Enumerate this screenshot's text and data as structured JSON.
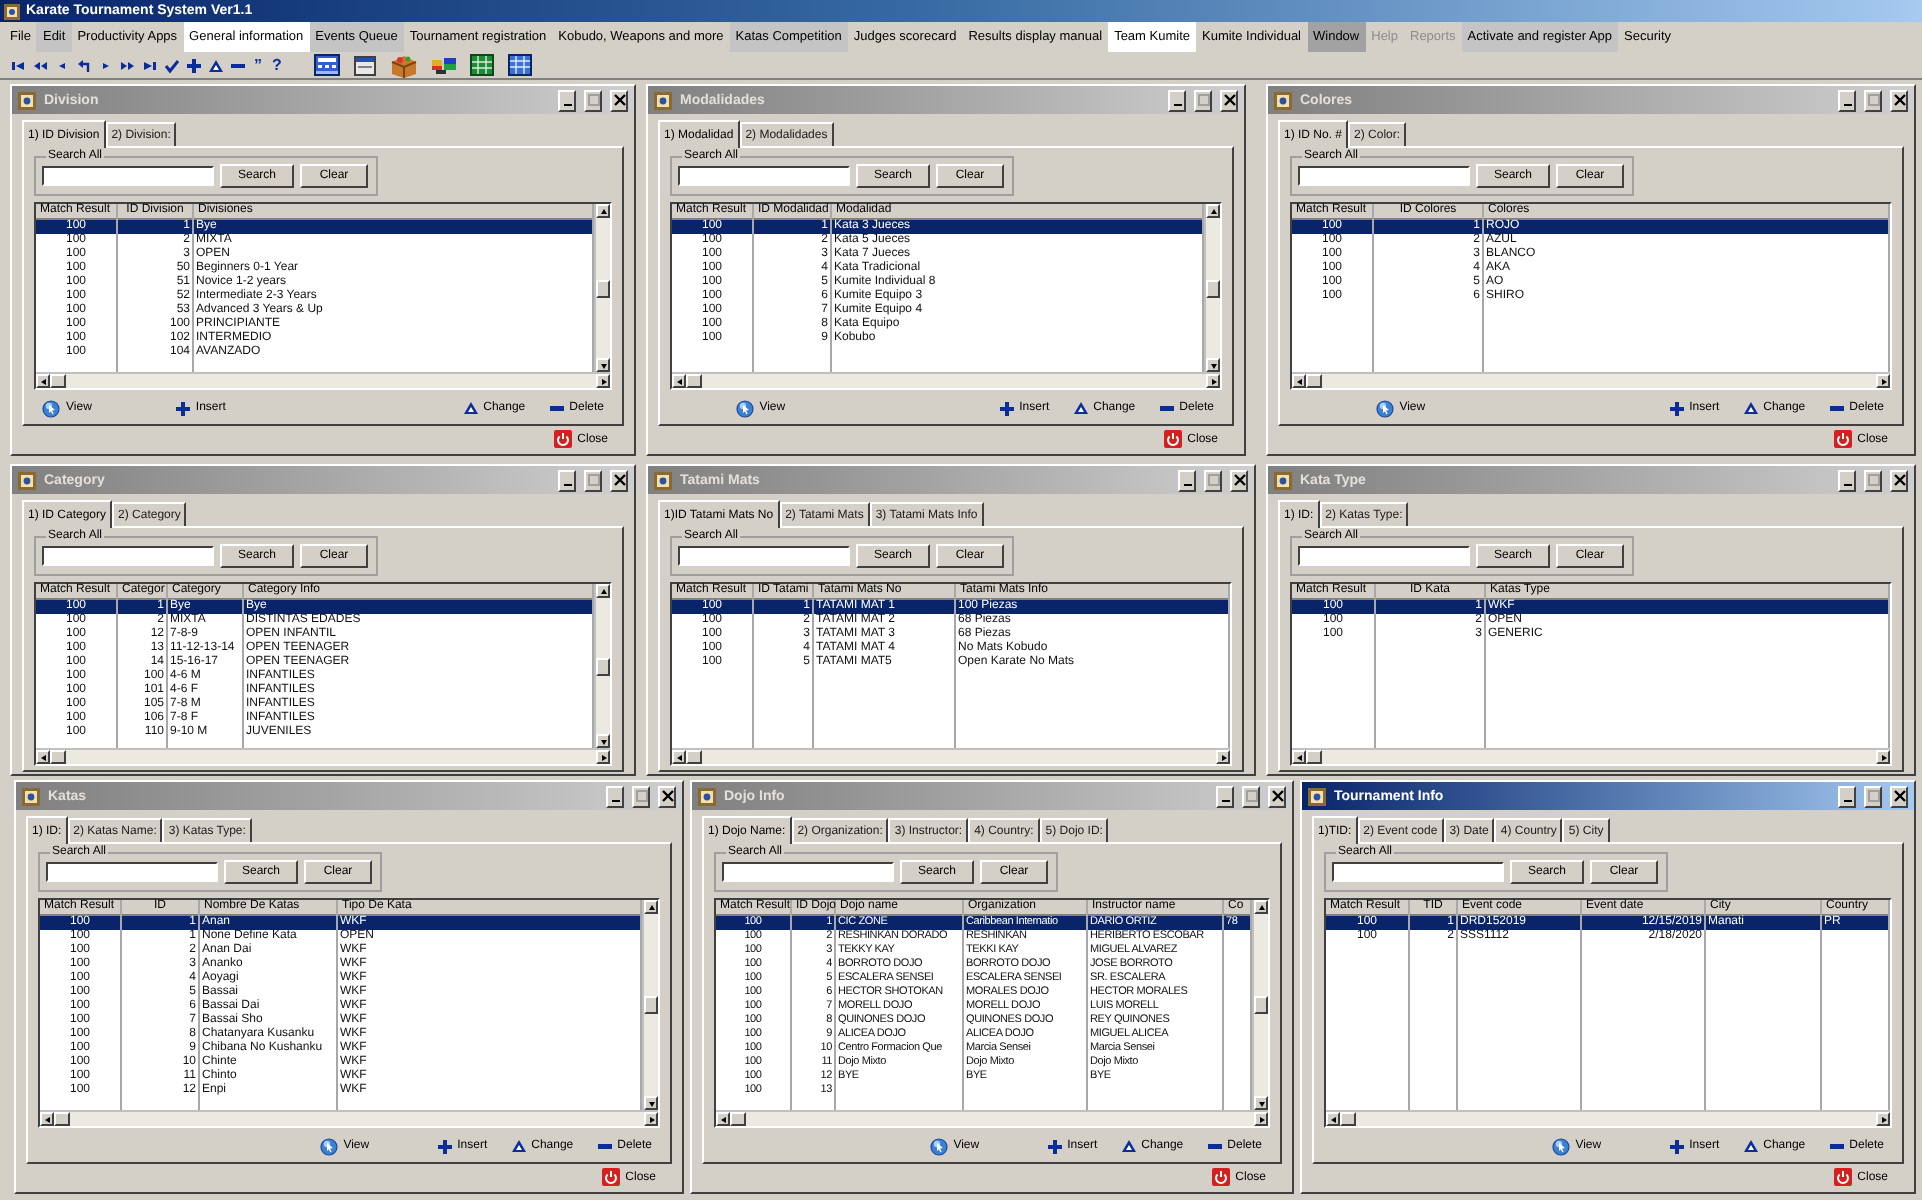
{
  "app_title": "Karate Tournament System Ver1.1",
  "menu": [
    {
      "label": "File",
      "kind": "plain",
      "disabled": false
    },
    {
      "label": "Edit",
      "kind": "shaded",
      "disabled": false
    },
    {
      "label": "Productivity Apps",
      "kind": "plain",
      "disabled": false
    },
    {
      "label": "General information",
      "kind": "light",
      "disabled": false
    },
    {
      "label": "Events Queue",
      "kind": "shaded",
      "disabled": false
    },
    {
      "label": "Tournament registration",
      "kind": "plain",
      "disabled": false
    },
    {
      "label": "Kobudo, Weapons and more",
      "kind": "plain",
      "disabled": false
    },
    {
      "label": "Katas Competition",
      "kind": "shaded",
      "disabled": false
    },
    {
      "label": "Judges scorecard",
      "kind": "plain",
      "disabled": false
    },
    {
      "label": "Results display manual",
      "kind": "plain",
      "disabled": false
    },
    {
      "label": "Team Kumite",
      "kind": "light",
      "disabled": false
    },
    {
      "label": "Kumite Individual",
      "kind": "plain",
      "disabled": false
    },
    {
      "label": "Window",
      "kind": "dark",
      "disabled": false
    },
    {
      "label": "Help",
      "kind": "plain",
      "disabled": true
    },
    {
      "label": "Reports",
      "kind": "plain",
      "disabled": true
    },
    {
      "label": "Activate and register App",
      "kind": "shaded",
      "disabled": false
    },
    {
      "label": "Security",
      "kind": "plain",
      "disabled": false
    }
  ],
  "toolbar": [
    {
      "kind": "first"
    },
    {
      "kind": "rewind"
    },
    {
      "kind": "previous"
    },
    {
      "kind": "undo"
    },
    {
      "kind": "next"
    },
    {
      "kind": "fast-forward"
    },
    {
      "kind": "last"
    },
    {
      "kind": "check"
    },
    {
      "kind": "add"
    },
    {
      "kind": "edit"
    },
    {
      "kind": "remove"
    },
    {
      "kind": "glyph",
      "text": "”"
    },
    {
      "kind": "glyph",
      "text": "?"
    },
    {
      "kind": "calculator"
    },
    {
      "kind": "window"
    },
    {
      "kind": "box"
    },
    {
      "kind": "flags"
    },
    {
      "kind": "sheet"
    },
    {
      "kind": "chart"
    }
  ],
  "windows": [
    {
      "title": "Division",
      "active": false,
      "tabs": [
        {
          "label": "1) ID Division",
          "selected": true
        },
        {
          "label": "2) Division:",
          "selected": false
        }
      ],
      "search_group": "Search All",
      "search_button": "Search",
      "clear_button": "Clear",
      "table": {
        "columns": [
          "Match Result",
          "ID Division",
          "Divisiones"
        ],
        "rows": [
          {
            "cells": [
              "100",
              "1",
              "Bye"
            ],
            "selected": true
          },
          {
            "cells": [
              "100",
              "2",
              "MIXTA"
            ],
            "selected": false
          },
          {
            "cells": [
              "100",
              "3",
              "OPEN"
            ],
            "selected": false
          },
          {
            "cells": [
              "100",
              "50",
              "Beginners 0-1 Year"
            ],
            "selected": false
          },
          {
            "cells": [
              "100",
              "51",
              "Novice 1-2 years"
            ],
            "selected": false
          },
          {
            "cells": [
              "100",
              "52",
              "Intermediate 2-3 Years"
            ],
            "selected": false
          },
          {
            "cells": [
              "100",
              "53",
              "Advanced 3 Years & Up"
            ],
            "selected": false
          },
          {
            "cells": [
              "100",
              "100",
              "PRINCIPIANTE"
            ],
            "selected": false
          },
          {
            "cells": [
              "100",
              "102",
              "INTERMEDIO"
            ],
            "selected": false
          },
          {
            "cells": [
              "100",
              "104",
              "AVANZADO"
            ],
            "selected": false
          }
        ]
      },
      "actions": [
        "View",
        "Insert",
        "Change",
        "Delete"
      ],
      "close_button": "Close"
    },
    {
      "title": "Modalidades",
      "active": false,
      "tabs": [
        {
          "label": "1) Modalidad",
          "selected": true
        },
        {
          "label": "2) Modalidades",
          "selected": false
        }
      ],
      "search_group": "Search All",
      "search_button": "Search",
      "clear_button": "Clear",
      "table": {
        "columns": [
          "Match Result",
          "ID Modalidad",
          "Modalidad"
        ],
        "rows": [
          {
            "cells": [
              "100",
              "1",
              "Kata 3 Jueces"
            ],
            "selected": true
          },
          {
            "cells": [
              "100",
              "2",
              "Kata 5 Jueces"
            ],
            "selected": false
          },
          {
            "cells": [
              "100",
              "3",
              "Kata 7 Jueces"
            ],
            "selected": false
          },
          {
            "cells": [
              "100",
              "4",
              "Kata Tradicional"
            ],
            "selected": false
          },
          {
            "cells": [
              "100",
              "5",
              "Kumite Individual 8"
            ],
            "selected": false
          },
          {
            "cells": [
              "100",
              "6",
              "Kumite Equipo 3"
            ],
            "selected": false
          },
          {
            "cells": [
              "100",
              "7",
              "Kumite Equipo 4"
            ],
            "selected": false
          },
          {
            "cells": [
              "100",
              "8",
              "Kata Equipo"
            ],
            "selected": false
          },
          {
            "cells": [
              "100",
              "9",
              "Kobubo"
            ],
            "selected": false
          }
        ]
      },
      "actions": [
        "View",
        "Insert",
        "Change",
        "Delete"
      ],
      "close_button": "Close"
    },
    {
      "title": "Colores",
      "active": false,
      "tabs": [
        {
          "label": "1) ID No. #",
          "selected": true
        },
        {
          "label": "2) Color:",
          "selected": false
        }
      ],
      "search_group": "Search All",
      "search_button": "Search",
      "clear_button": "Clear",
      "table": {
        "columns": [
          "Match Result",
          "ID Colores",
          "Colores"
        ],
        "rows": [
          {
            "cells": [
              "100",
              "1",
              "ROJO"
            ],
            "selected": true
          },
          {
            "cells": [
              "100",
              "2",
              "AZUL"
            ],
            "selected": false
          },
          {
            "cells": [
              "100",
              "3",
              "BLANCO"
            ],
            "selected": false
          },
          {
            "cells": [
              "100",
              "4",
              "AKA"
            ],
            "selected": false
          },
          {
            "cells": [
              "100",
              "5",
              "AO"
            ],
            "selected": false
          },
          {
            "cells": [
              "100",
              "6",
              "SHIRO"
            ],
            "selected": false
          }
        ]
      },
      "actions": [
        "View",
        "Insert",
        "Change",
        "Delete"
      ],
      "close_button": "Close"
    },
    {
      "title": "Category",
      "active": false,
      "tabs": [
        {
          "label": "1) ID Category",
          "selected": true
        },
        {
          "label": "2) Category",
          "selected": false
        }
      ],
      "search_group": "Search All",
      "search_button": "Search",
      "clear_button": "Clear",
      "table": {
        "columns": [
          "Match Result",
          "Categor",
          "Category",
          "Category Info"
        ],
        "rows": [
          {
            "cells": [
              "100",
              "1",
              "Bye",
              "Bye"
            ],
            "selected": true
          },
          {
            "cells": [
              "100",
              "2",
              "MIXTA",
              "DISTINTAS EDADES"
            ],
            "selected": false
          },
          {
            "cells": [
              "100",
              "12",
              "7-8-9",
              "OPEN INFANTIL"
            ],
            "selected": false
          },
          {
            "cells": [
              "100",
              "13",
              "11-12-13-14",
              "OPEN TEENAGER"
            ],
            "selected": false
          },
          {
            "cells": [
              "100",
              "14",
              "15-16-17",
              "OPEN  TEENAGER"
            ],
            "selected": false
          },
          {
            "cells": [
              "100",
              "100",
              "4-6 M",
              "INFANTILES"
            ],
            "selected": false
          },
          {
            "cells": [
              "100",
              "101",
              "4-6 F",
              "INFANTILES"
            ],
            "selected": false
          },
          {
            "cells": [
              "100",
              "105",
              "7-8 M",
              "INFANTILES"
            ],
            "selected": false
          },
          {
            "cells": [
              "100",
              "106",
              "7-8 F",
              "INFANTILES"
            ],
            "selected": false
          },
          {
            "cells": [
              "100",
              "110",
              "9-10 M",
              "JUVENILES"
            ],
            "selected": false
          }
        ]
      }
    },
    {
      "title": "Tatami Mats",
      "active": false,
      "tabs": [
        {
          "label": "1)ID Tatami Mats No",
          "selected": true
        },
        {
          "label": "2) Tatami Mats",
          "selected": false
        },
        {
          "label": "3) Tatami Mats Info",
          "selected": false
        }
      ],
      "search_group": "Search All",
      "search_button": "Search",
      "clear_button": "Clear",
      "table": {
        "columns": [
          "Match Result",
          "ID Tatami",
          "Tatami Mats No",
          "Tatami Mats Info"
        ],
        "rows": [
          {
            "cells": [
              "100",
              "1",
              "TATAMI MAT 1",
              "100 Piezas"
            ],
            "selected": true
          },
          {
            "cells": [
              "100",
              "2",
              "TATAMI MAT 2",
              "68 Piezas"
            ],
            "selected": false
          },
          {
            "cells": [
              "100",
              "3",
              "TATAMI MAT 3",
              "68 Piezas"
            ],
            "selected": false
          },
          {
            "cells": [
              "100",
              "4",
              "TATAMI MAT 4",
              "No Mats Kobudo"
            ],
            "selected": false
          },
          {
            "cells": [
              "100",
              "5",
              "TATAMI MAT5",
              "Open Karate No Mats"
            ],
            "selected": false
          }
        ]
      }
    },
    {
      "title": "Kata Type",
      "active": false,
      "tabs": [
        {
          "label": "1) ID:",
          "selected": true
        },
        {
          "label": "2) Katas Type:",
          "selected": false
        }
      ],
      "search_group": "Search All",
      "search_button": "Search",
      "clear_button": "Clear",
      "table": {
        "columns": [
          "Match Result",
          "ID Kata",
          "Katas Type"
        ],
        "rows": [
          {
            "cells": [
              "100",
              "1",
              "WKF"
            ],
            "selected": true
          },
          {
            "cells": [
              "100",
              "2",
              "OPEN"
            ],
            "selected": false
          },
          {
            "cells": [
              "100",
              "3",
              "GENERIC"
            ],
            "selected": false
          }
        ]
      }
    },
    {
      "title": "Katas",
      "active": false,
      "tabs": [
        {
          "label": "1) ID:",
          "selected": true
        },
        {
          "label": "2) Katas Name:",
          "selected": false
        },
        {
          "label": "3) Katas Type:",
          "selected": false
        }
      ],
      "search_group": "Search All",
      "search_button": "Search",
      "clear_button": "Clear",
      "table": {
        "columns": [
          "Match Result",
          "ID",
          "Nombre De Katas",
          "Tipo De Kata"
        ],
        "rows": [
          {
            "cells": [
              "100",
              "1",
              "Anan",
              "WKF"
            ],
            "selected": true
          },
          {
            "cells": [
              "100",
              "1",
              "None Define Kata",
              "OPEN"
            ],
            "selected": false
          },
          {
            "cells": [
              "100",
              "2",
              "Anan Dai",
              "WKF"
            ],
            "selected": false
          },
          {
            "cells": [
              "100",
              "3",
              "Ananko",
              "WKF"
            ],
            "selected": false
          },
          {
            "cells": [
              "100",
              "4",
              "Aoyagi",
              "WKF"
            ],
            "selected": false
          },
          {
            "cells": [
              "100",
              "5",
              "Bassai",
              "WKF"
            ],
            "selected": false
          },
          {
            "cells": [
              "100",
              "6",
              "Bassai Dai",
              "WKF"
            ],
            "selected": false
          },
          {
            "cells": [
              "100",
              "7",
              "Bassai Sho",
              "WKF"
            ],
            "selected": false
          },
          {
            "cells": [
              "100",
              "8",
              "Chatanyara Kusanku",
              "WKF"
            ],
            "selected": false
          },
          {
            "cells": [
              "100",
              "9",
              "Chibana No Kushanku",
              "WKF"
            ],
            "selected": false
          },
          {
            "cells": [
              "100",
              "10",
              "Chinte",
              "WKF"
            ],
            "selected": false
          },
          {
            "cells": [
              "100",
              "11",
              "Chinto",
              "WKF"
            ],
            "selected": false
          },
          {
            "cells": [
              "100",
              "12",
              "Enpi",
              "WKF"
            ],
            "selected": false
          }
        ]
      },
      "actions": [
        "View",
        "Insert",
        "Change",
        "Delete"
      ],
      "close_button": "Close"
    },
    {
      "title": "Dojo Info",
      "active": false,
      "tabs": [
        {
          "label": "1) Dojo Name:",
          "selected": true
        },
        {
          "label": "2) Organization:",
          "selected": false
        },
        {
          "label": "3) Instructor:",
          "selected": false
        },
        {
          "label": "4) Country:",
          "selected": false
        },
        {
          "label": "5) Dojo ID:",
          "selected": false
        }
      ],
      "search_group": "Search All",
      "search_button": "Search",
      "clear_button": "Clear",
      "table": {
        "columns": [
          "Match Result",
          "ID Dojo",
          "Dojo name",
          "Organization",
          "Instructor name",
          "Co"
        ],
        "rows": [
          {
            "cells": [
              "100",
              "1",
              "CIC ZONE",
              "Caribbean Internatio",
              "DARIO ORTIZ",
              "78"
            ],
            "selected": true
          },
          {
            "cells": [
              "100",
              "2",
              "RESHINKAN DORADO",
              "RESHINKAN",
              "HERIBERTO ESCOBAR"
            ],
            "selected": false
          },
          {
            "cells": [
              "100",
              "3",
              "TEKKY KAY",
              "TEKKI KAY",
              "MIGUEL ALVAREZ"
            ],
            "selected": false
          },
          {
            "cells": [
              "100",
              "4",
              "BORROTO  DOJO",
              "BORROTO  DOJO",
              "JOSE  BORROTO"
            ],
            "selected": false
          },
          {
            "cells": [
              "100",
              "5",
              "ESCALERA SENSEI",
              "ESCALERA SENSEI",
              "SR. ESCALERA"
            ],
            "selected": false
          },
          {
            "cells": [
              "100",
              "6",
              "HECTOR SHOTOKAN",
              "MORALES DOJO",
              "HECTOR MORALES"
            ],
            "selected": false
          },
          {
            "cells": [
              "100",
              "7",
              "MORELL DOJO",
              "MORELL DOJO",
              "LUIS MORELL"
            ],
            "selected": false
          },
          {
            "cells": [
              "100",
              "8",
              "QUINONES DOJO",
              "QUINONES DOJO",
              "REY QUINONES"
            ],
            "selected": false
          },
          {
            "cells": [
              "100",
              "9",
              "ALICEA DOJO",
              "ALICEA DOJO",
              "MIGUEL ALICEA"
            ],
            "selected": false
          },
          {
            "cells": [
              "100",
              "10",
              "Centro Formacion Que",
              "Marcia Sensei",
              "Marcia Sensei"
            ],
            "selected": false
          },
          {
            "cells": [
              "100",
              "11",
              "Dojo Mixto",
              "Dojo Mixto",
              "Dojo Mixto"
            ],
            "selected": false
          },
          {
            "cells": [
              "100",
              "12",
              "BYE",
              "BYE",
              "BYE"
            ],
            "selected": false
          },
          {
            "cells": [
              "100",
              "13"
            ],
            "selected": false
          }
        ]
      },
      "actions": [
        "View",
        "Insert",
        "Change",
        "Delete"
      ],
      "close_button": "Close"
    },
    {
      "title": "Tournament Info",
      "active": true,
      "tabs": [
        {
          "label": "1)TID:",
          "selected": true
        },
        {
          "label": "2) Event code",
          "selected": false
        },
        {
          "label": "3) Date",
          "selected": false
        },
        {
          "label": "4) Country",
          "selected": false
        },
        {
          "label": "5) City",
          "selected": false
        }
      ],
      "search_group": "Search All",
      "search_button": "Search",
      "clear_button": "Clear",
      "table": {
        "columns": [
          "Match Result",
          "TID",
          "Event code",
          "Event date",
          "City",
          "Country"
        ],
        "rows": [
          {
            "cells": [
              "100",
              "1",
              "DRD152019",
              "12/15/2019",
              "Manati",
              "PR"
            ],
            "selected": true
          },
          {
            "cells": [
              "100",
              "2",
              "SSS1112",
              "2/18/2020"
            ],
            "selected": false
          }
        ]
      },
      "actions": [
        "View",
        "Insert",
        "Change",
        "Delete"
      ],
      "close_button": "Close"
    }
  ]
}
